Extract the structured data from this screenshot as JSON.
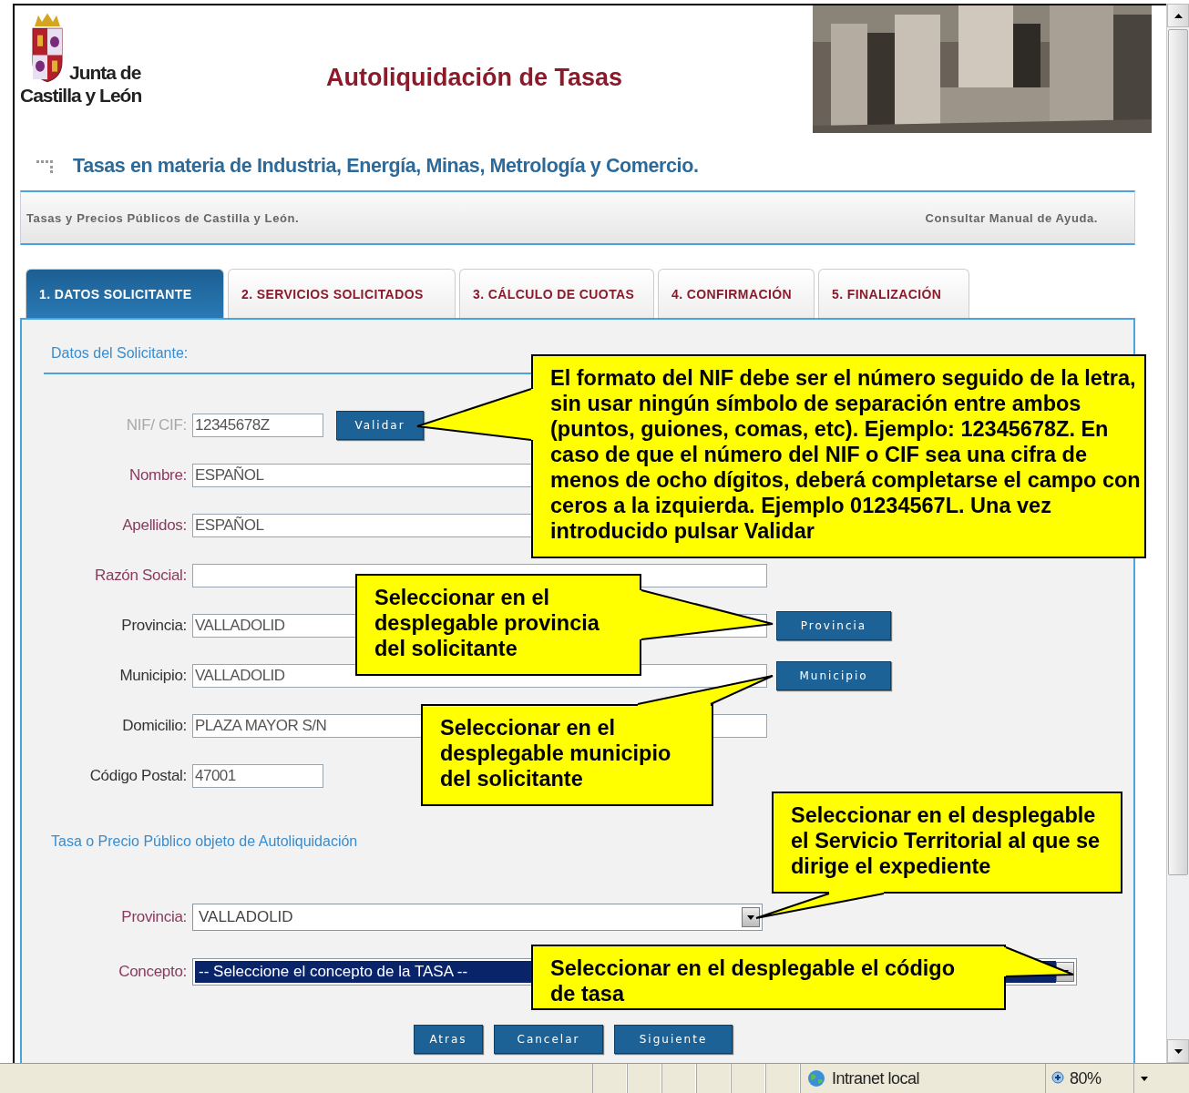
{
  "header": {
    "logo": [
      "Junta de",
      "Castilla y León"
    ],
    "title": "Autoliquidación de Tasas"
  },
  "subtitle": "Tasas en materia de Industria, Energía, Minas, Metrología y Comercio.",
  "breadcrumb": {
    "path": "Tasas y Precios Públicos de Castilla y León.",
    "help_link": "Consultar Manual de Ayuda."
  },
  "tabs": [
    {
      "label": "1. DATOS SOLICITANTE",
      "selected": true
    },
    {
      "label": "2. SERVICIOS SOLICITADOS",
      "selected": false
    },
    {
      "label": "3. CÁLCULO DE CUOTAS",
      "selected": false
    },
    {
      "label": "4. CONFIRMACIÓN",
      "selected": false
    },
    {
      "label": "5. FINALIZACIÓN",
      "selected": false
    }
  ],
  "applicant": {
    "heading": "Datos del Solicitante:",
    "fields": [
      {
        "label": "NIF/ CIF:",
        "value": "12345678Z",
        "color": "#a8a8a8",
        "kind": "short",
        "button": "Validar"
      },
      {
        "label": "Nombre:",
        "value": "ESPAÑOL",
        "color": "#8a3a5e",
        "kind": "long"
      },
      {
        "label": "Apellidos:",
        "value": "ESPAÑOL",
        "color": "#8a3a5e",
        "kind": "long"
      },
      {
        "label": "Razón Social:",
        "color": "#8a3a5e",
        "kind": "long"
      },
      {
        "label": "Provincia:",
        "value": "VALLADOLID",
        "color": "#333333",
        "kind": "long",
        "button": "Provincia"
      },
      {
        "label": "Municipio:",
        "value": "VALLADOLID",
        "color": "#333333",
        "kind": "long",
        "button": "Municipio"
      },
      {
        "label": "Domicilio:",
        "value": "PLAZA MAYOR S/N",
        "color": "#333333",
        "kind": "long"
      },
      {
        "label": "Código Postal:",
        "value": "47001",
        "color": "#333333",
        "kind": "short"
      }
    ]
  },
  "fee": {
    "heading": "Tasa o Precio Público objeto de Autoliquidación",
    "selects": [
      {
        "label": "Provincia:",
        "value": "VALLADOLID",
        "kind": "medium",
        "focused": false
      },
      {
        "label": "Concepto:",
        "value": "-- Seleccione el concepto de la TASA --",
        "kind": "wide",
        "focused": true
      }
    ]
  },
  "buttons": [
    "Atras",
    "Cancelar",
    "Siguiente"
  ],
  "callouts": [
    "El formato del NIF debe ser el número seguido de la letra, sin usar ningún símbolo de separación entre ambos (puntos, guiones, comas, etc). Ejemplo: 12345678Z. En caso de que el número del NIF o CIF sea una cifra de menos de ocho dígitos, deberá completarse el campo con ceros a la izquierda. Ejemplo 01234567L. Una vez introducido pulsar Validar",
    "Seleccionar en el desplegable provincia del solicitante",
    "Seleccionar en el desplegable municipio del solicitante",
    "Seleccionar en el desplegable el Servicio Territorial al que se dirige el expediente",
    "Seleccionar en el desplegable el código de tasa"
  ],
  "status_bar": {
    "zone": "Intranet local",
    "zoom": "80%"
  }
}
